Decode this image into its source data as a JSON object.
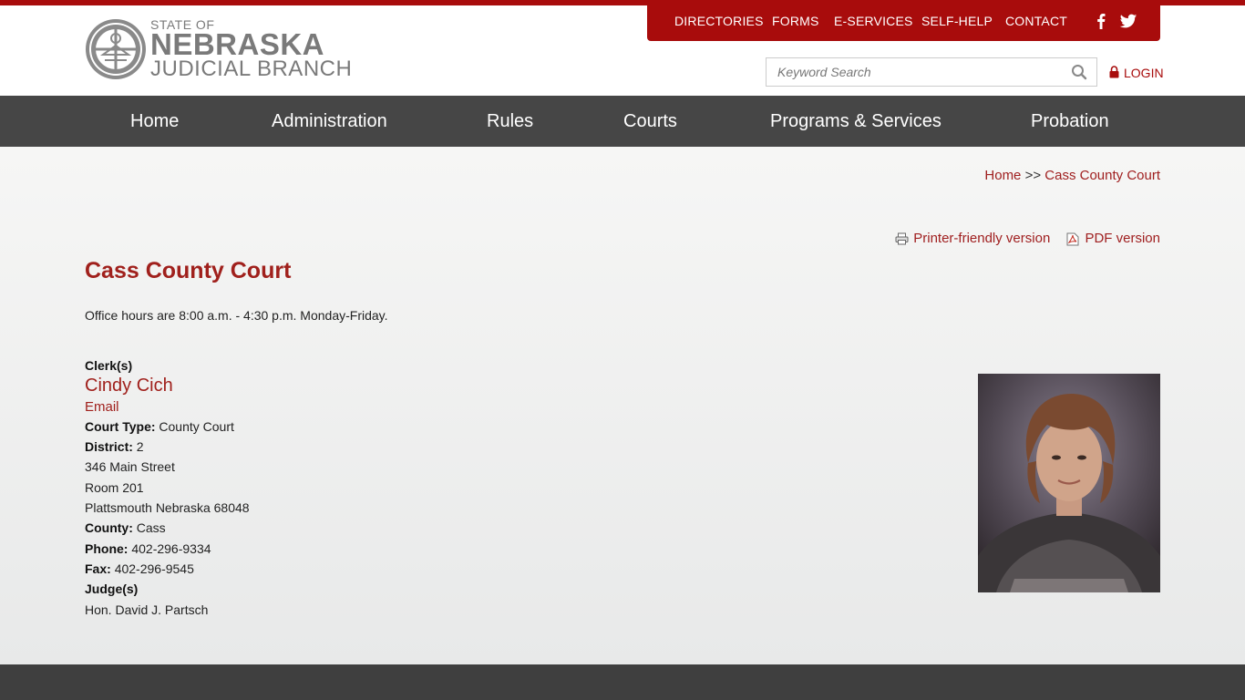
{
  "logo": {
    "line1": "STATE OF",
    "line2": "NEBRASKA",
    "line3": "JUDICIAL BRANCH"
  },
  "utility_nav": [
    "DIRECTORIES",
    "FORMS",
    "E-SERVICES",
    "SELF-HELP",
    "CONTACT"
  ],
  "social": [
    "facebook-icon",
    "twitter-icon"
  ],
  "search": {
    "placeholder": "Keyword Search",
    "value": ""
  },
  "login": {
    "label": "LOGIN"
  },
  "main_nav": [
    "Home",
    "Administration",
    "Rules",
    "Courts",
    "Programs & Services",
    "Probation"
  ],
  "breadcrumb": {
    "home": "Home",
    "separator": ">>",
    "current": "Cass County Court"
  },
  "print_links": {
    "printer": "Printer-friendly version",
    "pdf": "PDF version"
  },
  "page": {
    "title": "Cass County Court",
    "office_hours": "Office hours are 8:00 a.m. - 4:30 p.m. Monday-Friday."
  },
  "details": {
    "clerk_label": "Clerk(s)",
    "clerk_name": "Cindy Cich",
    "email_label": "Email",
    "court_type_label": "Court Type:",
    "court_type": "County Court",
    "district_label": "District:",
    "district": "2",
    "address1": "346 Main Street",
    "address2": "Room 201",
    "address3": "Plattsmouth Nebraska 68048",
    "county_label": "County:",
    "county": "Cass",
    "phone_label": "Phone:",
    "phone": "402-296-9334",
    "fax_label": "Fax:",
    "fax": "402-296-9545",
    "judge_label": "Judge(s)",
    "judge": "Hon. David J. Partsch"
  },
  "colors": {
    "brand_red": "#a80c0c",
    "nav_gray": "#464646",
    "link_red": "#a0201c"
  }
}
